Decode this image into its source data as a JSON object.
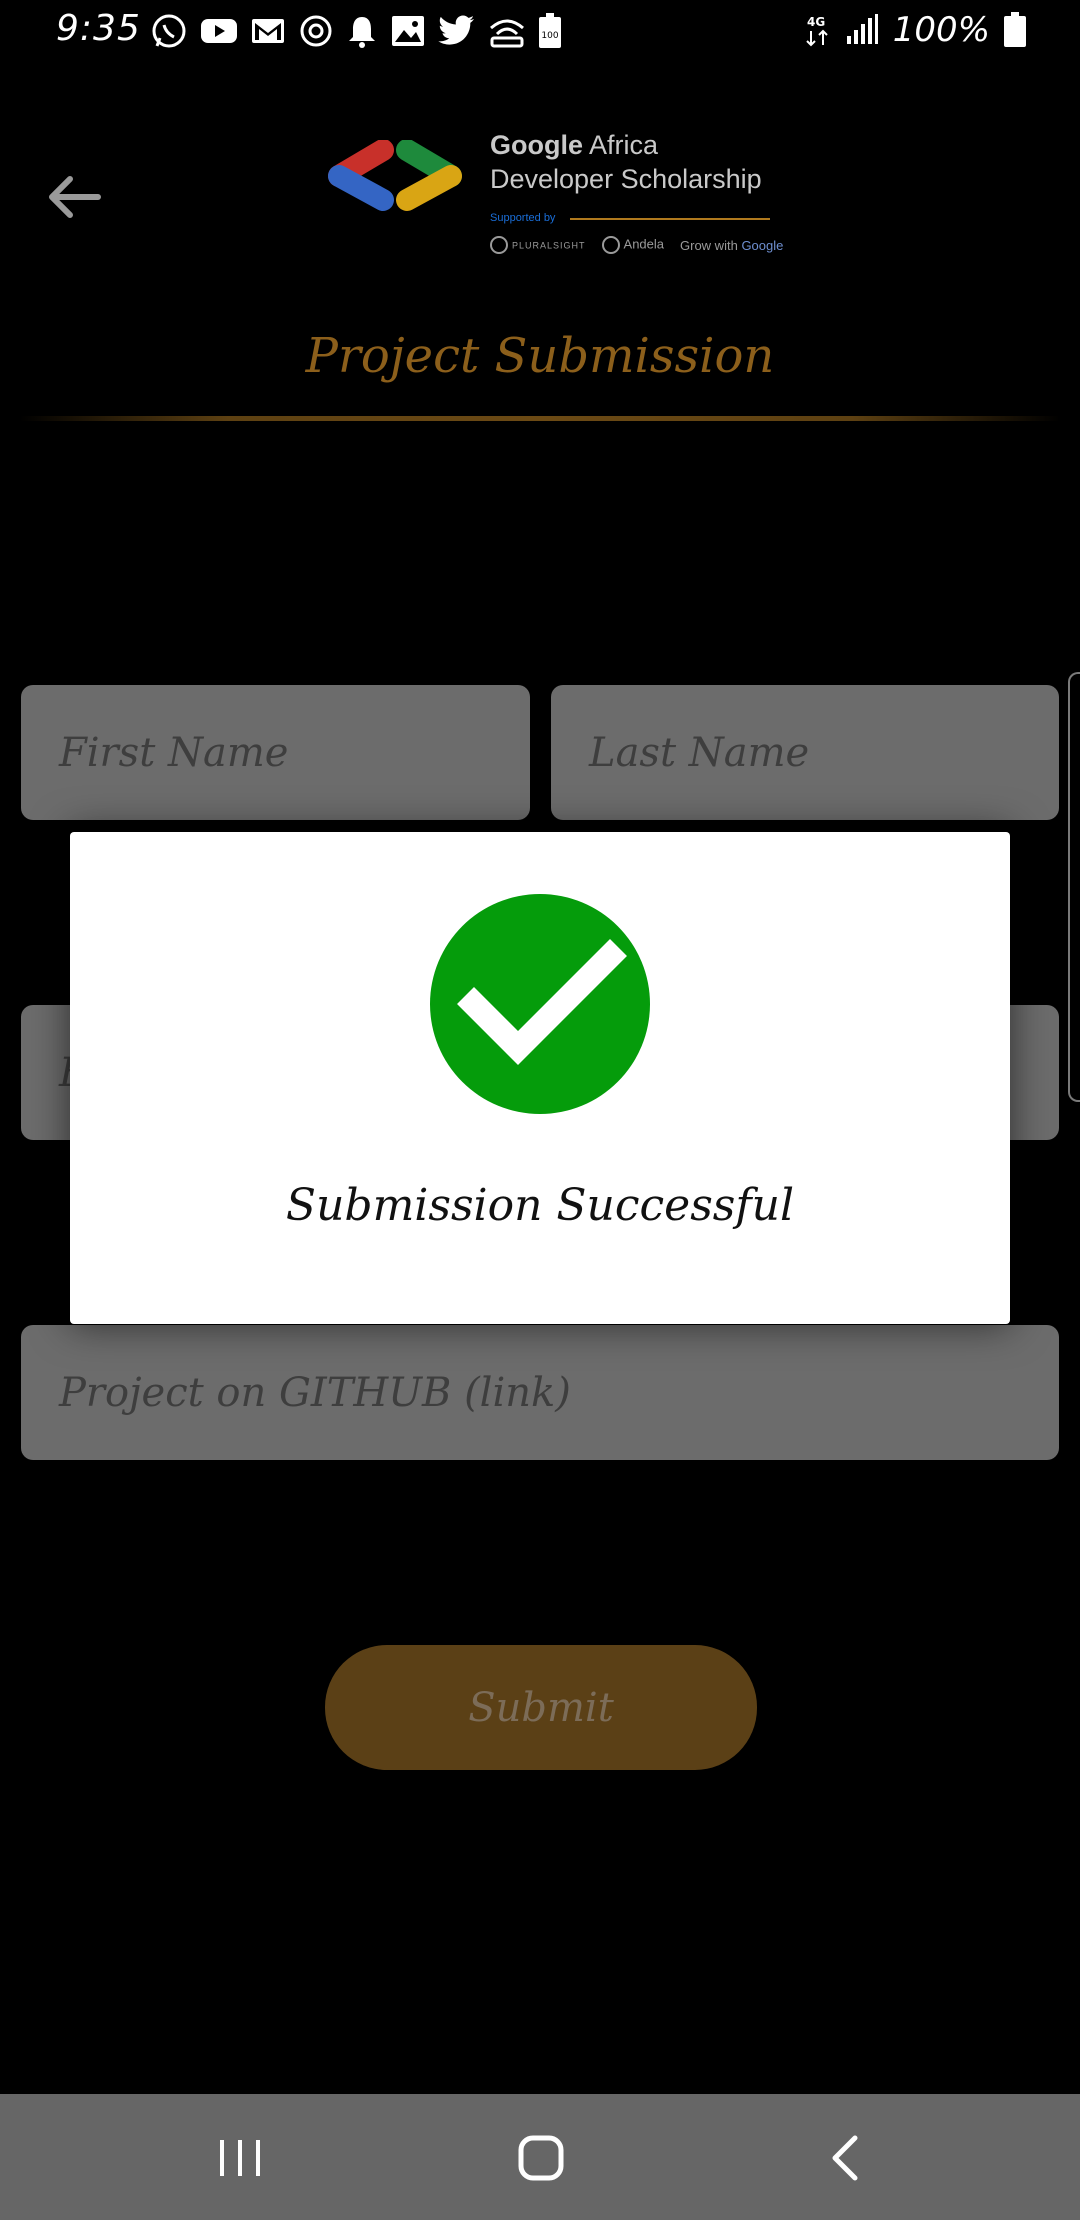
{
  "status_bar": {
    "time": "9:35",
    "battery_percent": "100%",
    "network": "4G",
    "notification_icons": [
      "whatsapp-icon",
      "youtube-icon",
      "gmail-icon",
      "sync-icon",
      "bell-icon",
      "gallery-icon",
      "twitter-icon",
      "wifi-hotspot-icon",
      "battery-saver-icon"
    ],
    "battery_icon_label": "100"
  },
  "header": {
    "back_icon": "arrow-left-icon",
    "brand": {
      "title_line1_bold": "Google",
      "title_line1_rest": " Africa",
      "title_line2": "Developer Scholarship",
      "supported_by": "Supported by",
      "partners": [
        "PLURALSIGHT",
        "Andela",
        "Grow with",
        "Google"
      ]
    },
    "page_title": "Project Submission"
  },
  "form": {
    "first_name_placeholder": "First Name",
    "last_name_placeholder": "Last Name",
    "email_placeholder_partial": "E",
    "github_placeholder": "Project on GITHUB (link)",
    "submit_label": "Submit"
  },
  "dialog": {
    "icon": "check-circle-icon",
    "message": "Submission Successful"
  },
  "navigation_bar": {
    "items": [
      "recents-icon",
      "home-icon",
      "back-icon"
    ]
  },
  "colors": {
    "background": "#000000",
    "accent": "#8c5f1b",
    "field_bg": "#6c6c6c",
    "success_green": "#059c0b",
    "dialog_bg": "#ffffff"
  }
}
